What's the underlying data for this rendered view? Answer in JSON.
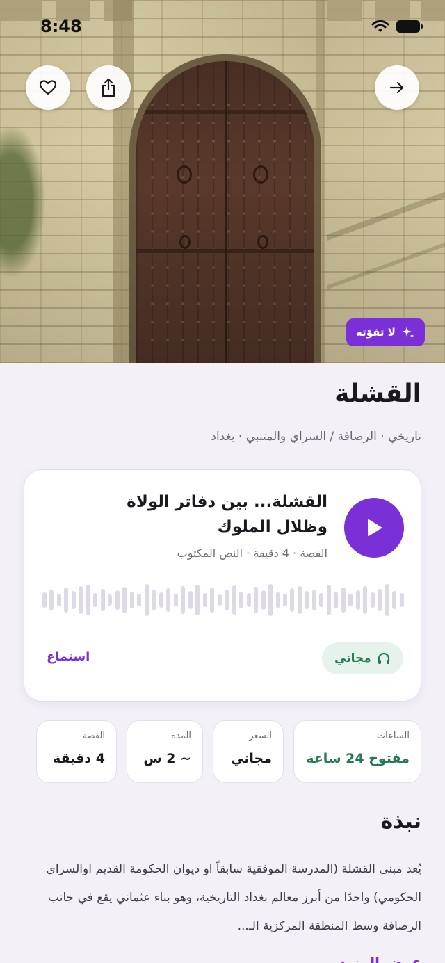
{
  "status_bar": {
    "time": "8:48"
  },
  "hero": {
    "badge_label": "لا تفوّته",
    "buttons": [
      "heart-icon",
      "share-icon",
      "arrow-right-icon"
    ]
  },
  "place": {
    "title": "القشلة",
    "meta": "تاريخي · الرصافة / السراي والمتنبي · بغداد"
  },
  "audio": {
    "title": "القشلة... بين دفاتر الولاة وظلال الملوك",
    "subtitle": "القصة · 4 دقيقة · النص المكتوب",
    "free_label": "مجاني",
    "listen_label": "استماع",
    "accent": "#7b2fd6"
  },
  "info": {
    "hours_label": "الساعات",
    "hours_value": "مفتوح 24 ساعة",
    "price_label": "السعر",
    "price_value": "مجاني",
    "duration_label": "المدة",
    "duration_value": "~ 2 س",
    "story_label": "القصة",
    "story_value": "4 دقيقة"
  },
  "about": {
    "heading": "نبذة",
    "text": "يُعد مبنى القشلة (المدرسة الموفقية سابقاً او ديوان الحكومة القديم اوالسراي الحكومي) واحدًا من أبرز معالم بغداد التاريخية، وهو بناء عثماني يقع في جانب الرصافة وسط المنطقة المركزية الـ...",
    "read_more": "عرض المزيد"
  },
  "colors": {
    "purple": "#7b2fd6",
    "green": "#257a52",
    "background": "#f3f0f8"
  }
}
